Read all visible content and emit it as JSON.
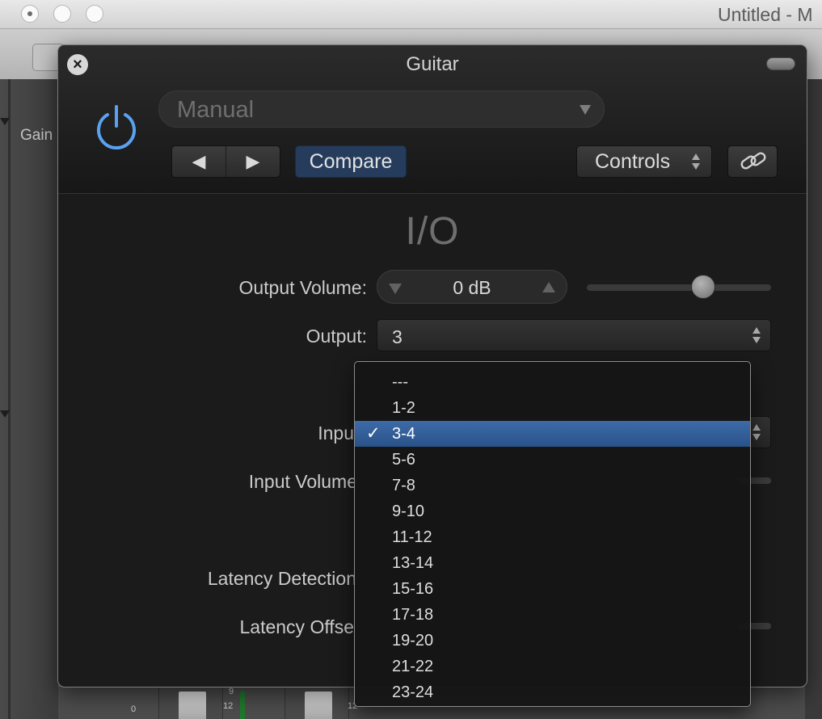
{
  "host": {
    "window_title": "Untitled - M",
    "side_label": "Gain",
    "meter_scale": [
      "0",
      "9",
      "12",
      "15",
      "12"
    ]
  },
  "plugin": {
    "title": "Guitar",
    "preset": {
      "value": "Manual"
    },
    "compare_label": "Compare",
    "controls_label": "Controls",
    "section_title": "I/O",
    "params": {
      "output_volume": {
        "label": "Output Volume:",
        "value": "0 dB",
        "slider_level": 0.65
      },
      "output": {
        "label": "Output:",
        "value": "3"
      },
      "input": {
        "label": "Inpu"
      },
      "input_volume": {
        "label": "Input Volume"
      },
      "latency_detection": {
        "label": "Latency Detection"
      },
      "latency_offset": {
        "label": "Latency Offse"
      }
    }
  },
  "dropdown": {
    "selected": "3-4",
    "items": [
      "---",
      "1-2",
      "3-4",
      "5-6",
      "7-8",
      "9-10",
      "11-12",
      "13-14",
      "15-16",
      "17-18",
      "19-20",
      "21-22",
      "23-24"
    ]
  },
  "colors": {
    "power_accent": "#5aa2f0",
    "compare_active": "#263c5c",
    "menu_highlight": "#2f5b96"
  },
  "icons": [
    "power-icon",
    "prev-arrow-icon",
    "next-arrow-icon",
    "link-icon",
    "close-icon",
    "checkmark-icon"
  ]
}
